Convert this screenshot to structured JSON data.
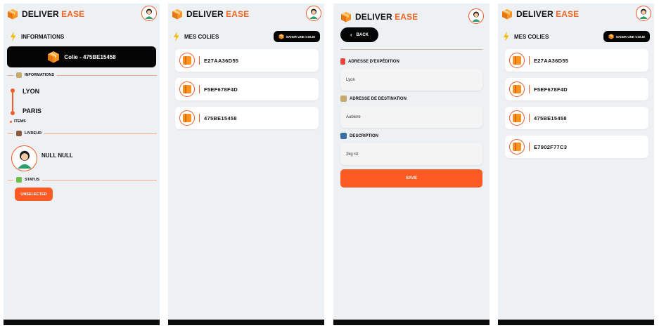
{
  "brand": {
    "part1": "DELIVER",
    "part2": "EASE",
    "accent": "#f26522"
  },
  "detail": {
    "section_title": "INFORMATIONS",
    "colie_label": "Colie - 475BE15458",
    "info_divider": "INFORMATIONS",
    "origin": "LYON",
    "destination": "PARIS",
    "items_label": "ITEMS",
    "livreur_divider": "LIVREUR",
    "driver_name": "NULL NULL",
    "status_divider": "STATUS",
    "status_badge": "UNSELECTED"
  },
  "list_a": {
    "section_title": "MES COLIES",
    "add_button": "SAISIR UNE COLIE",
    "items": [
      "E27AA36D55",
      "F5EF678F4D",
      "475BE15458"
    ]
  },
  "form": {
    "back_button": "BACK",
    "origin_label": "ADRESSE D'EXPÉDITION",
    "origin_value": "Lyon",
    "dest_label": "ADRESSE DE DESTINATION",
    "dest_value": "Aubiere",
    "desc_label": "DESCRIPTION",
    "desc_value": "2kg riz",
    "save_button": "SAVE"
  },
  "list_b": {
    "section_title": "MES COLIES",
    "add_button": "SAISIR UNE COLIE",
    "items": [
      "E27AA36D55",
      "F5EF678F4D",
      "475BE15458",
      "E7902F77C3"
    ]
  }
}
